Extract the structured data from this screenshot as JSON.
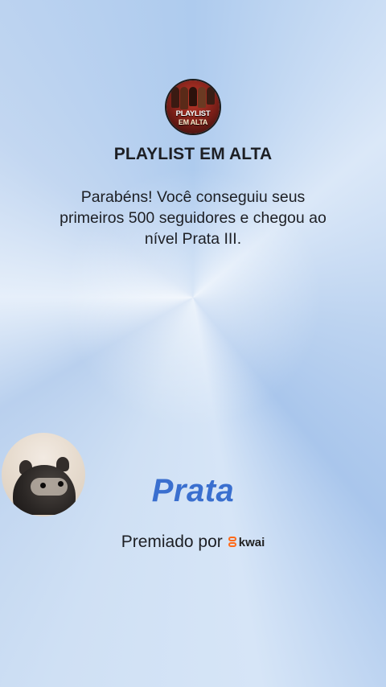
{
  "header": {
    "logo_line1": "PLAYLIST",
    "logo_line2": "EM ALTA",
    "title": "PLAYLIST EM ALTA"
  },
  "message": "Parabéns! Você conseguiu seus primeiros 500 seguidores e chegou ao nível Prata III.",
  "level": {
    "name": "Prata",
    "color": "#3a6fcf"
  },
  "sponsor": {
    "prefix": "Premiado por",
    "brand": "kwai",
    "brand_color": "#ff6a1a"
  },
  "avatar": {
    "icon": "raccoon-avatar"
  }
}
